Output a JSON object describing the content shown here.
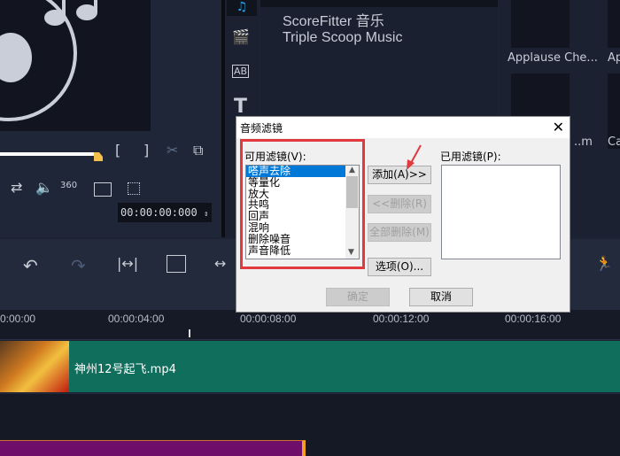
{
  "library": {
    "nav_items": [
      "音效",
      "ScoreFitter 音乐",
      "Triple Scoop Music"
    ],
    "thumbnails": [
      {
        "label": "Applause Che..."
      },
      {
        "label": "Ap"
      },
      {
        "label": "..m"
      },
      {
        "label": "Ca"
      }
    ]
  },
  "player": {
    "timecode": "00:00:00:000"
  },
  "timeline": {
    "ruler": [
      "0:00:00",
      "00:00:04:00",
      "00:00:08:00",
      "00:00:12:00",
      "00:00:16:00"
    ],
    "video_clip": "神州12号起飞.mp4"
  },
  "dialog": {
    "title": "音频滤镜",
    "available_label": "可用滤镜(V):",
    "applied_label": "已用滤镜(P):",
    "available_filters": [
      "嗒声去除",
      "等量化",
      "放大",
      "共鸣",
      "回声",
      "混响",
      "删除噪音",
      "声音降低"
    ],
    "selected_filter": "嗒声去除",
    "add_button": "添加(A)>>",
    "remove_button": "<<删除(R)",
    "remove_all_button": "全部删除(M)",
    "options_button": "选项(O)...",
    "ok_button": "确定",
    "cancel_button": "取消"
  },
  "colors": {
    "highlight": "#e0393e",
    "selection": "#0078d7",
    "video_track": "#0f6e5c"
  }
}
